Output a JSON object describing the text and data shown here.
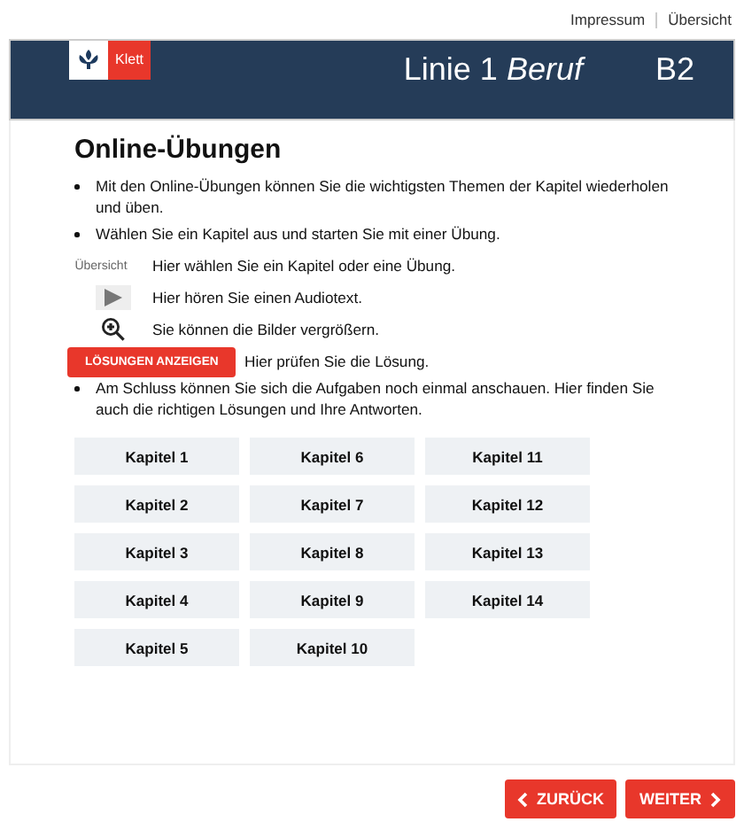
{
  "top_links": [
    "Impressum",
    "Übersicht"
  ],
  "header": {
    "logo_text": "Klett",
    "title": "Linie 1",
    "title_italic": "Beruf",
    "level": "B2"
  },
  "heading": "Online-Übungen",
  "bullets_top": [
    "Mit den Online-Übungen können Sie die wichtigsten Themen der Kapitel wiederholen und üben.",
    "Wählen Sie ein Kapitel aus und starten Sie mit einer Übung."
  ],
  "legend": [
    {
      "kind": "link",
      "label": "Übersicht",
      "text": "Hier wählen Sie ein Kapitel oder eine Übung."
    },
    {
      "kind": "play",
      "text": "Hier hören Sie einen Audiotext."
    },
    {
      "kind": "zoom",
      "text": "Sie können die Bilder vergrößern."
    },
    {
      "kind": "button",
      "label": "LÖSUNGEN ANZEIGEN",
      "text": "Hier prüfen Sie die Lösung."
    }
  ],
  "bullets_bottom": [
    "Am Schluss können Sie sich die Aufgaben noch einmal anschauen. Hier finden Sie auch die richtigen Lösungen und Ihre Antworten."
  ],
  "chapters": [
    [
      "Kapitel 1",
      "Kapitel 2",
      "Kapitel 3",
      "Kapitel 4",
      "Kapitel 5"
    ],
    [
      "Kapitel 6",
      "Kapitel 7",
      "Kapitel 8",
      "Kapitel 9",
      "Kapitel 10"
    ],
    [
      "Kapitel 11",
      "Kapitel 12",
      "Kapitel 13",
      "Kapitel 14"
    ]
  ],
  "nav": {
    "back": "ZURÜCK",
    "next": "WEITER"
  }
}
